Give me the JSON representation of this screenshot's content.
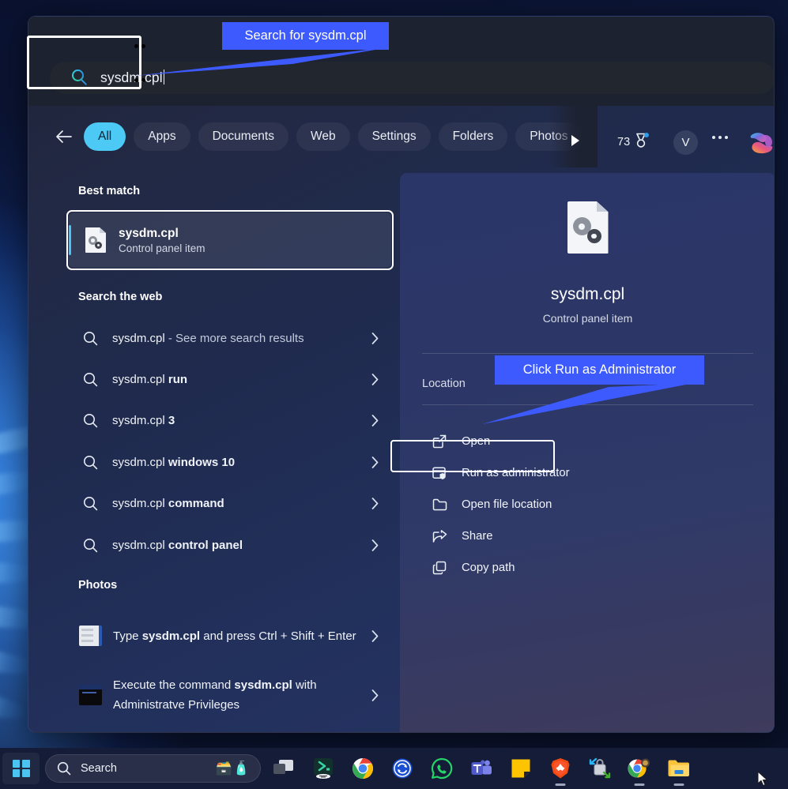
{
  "search": {
    "value": "sysdm.cpl",
    "icon": "search-icon"
  },
  "tabs": {
    "back_icon": "back-arrow-icon",
    "items": [
      {
        "label": "All",
        "active": true
      },
      {
        "label": "Apps",
        "active": false
      },
      {
        "label": "Documents",
        "active": false
      },
      {
        "label": "Web",
        "active": false
      },
      {
        "label": "Settings",
        "active": false
      },
      {
        "label": "Folders",
        "active": false
      },
      {
        "label": "Photos",
        "active": false
      }
    ],
    "scroll_next_icon": "play-right-icon",
    "rewards_count": "73",
    "rewards_icon": "medal-icon",
    "avatar_initial": "V",
    "more_icon": "ellipsis-icon",
    "copilot_icon": "copilot-icon"
  },
  "left": {
    "best_match_heading": "Best match",
    "best_match": {
      "title": "sysdm.cpl",
      "subtitle": "Control panel item",
      "icon": "cpl-file-icon"
    },
    "web_heading": "Search the web",
    "web_results": [
      {
        "query": "sysdm.cpl",
        "suffix": " - See more search results",
        "suffix_style": "dim"
      },
      {
        "query": "sysdm.cpl",
        "suffix": " run",
        "suffix_style": "bold"
      },
      {
        "query": "sysdm.cpl",
        "suffix": " 3",
        "suffix_style": "bold"
      },
      {
        "query": "sysdm.cpl",
        "suffix": " windows 10",
        "suffix_style": "bold"
      },
      {
        "query": "sysdm.cpl",
        "suffix": " command",
        "suffix_style": "bold"
      },
      {
        "query": "sysdm.cpl",
        "suffix": " control panel",
        "suffix_style": "bold"
      }
    ],
    "photos_heading": "Photos",
    "photos": [
      {
        "pre": "Type ",
        "bold": "sysdm.cpl",
        "post": " and press Ctrl + Shift + Enter",
        "thumb": "dialog-thumbnail"
      },
      {
        "pre": "Execute the command ",
        "bold": "sysdm.cpl",
        "post": " with Administratve Privileges",
        "thumb": "terminal-thumbnail"
      }
    ]
  },
  "preview": {
    "title": "sysdm.cpl",
    "subtitle": "Control panel item",
    "location_label": "Location",
    "actions": [
      {
        "label": "Open",
        "icon": "open-external-icon",
        "highlighted": false
      },
      {
        "label": "Run as administrator",
        "icon": "shield-window-icon",
        "highlighted": true
      },
      {
        "label": "Open file location",
        "icon": "folder-icon",
        "highlighted": false
      },
      {
        "label": "Share",
        "icon": "share-icon",
        "highlighted": false
      },
      {
        "label": "Copy path",
        "icon": "copy-icon",
        "highlighted": false
      }
    ]
  },
  "callouts": [
    {
      "text": "Search for sysdm.cpl",
      "color": "#3D5AFE"
    },
    {
      "text": "Click Run as Administrator",
      "color": "#3D5AFE"
    }
  ],
  "taskbar": {
    "start_icon": "windows-logo-icon",
    "search_placeholder": "Search",
    "search_icon": "search-icon",
    "search_emoji": "🗃️🧴",
    "apps": [
      {
        "name": "task-view-icon"
      },
      {
        "name": "app-green-icon"
      },
      {
        "name": "google-chrome-icon"
      },
      {
        "name": "sync-blue-icon"
      },
      {
        "name": "whatsapp-icon"
      },
      {
        "name": "microsoft-teams-icon"
      },
      {
        "name": "sticky-notes-icon"
      },
      {
        "name": "brave-browser-icon"
      },
      {
        "name": "unlocker-icon"
      },
      {
        "name": "chrome-secondary-icon"
      },
      {
        "name": "file-explorer-icon"
      }
    ]
  },
  "colors": {
    "accent_cyan": "#4CC9F5",
    "callout_blue": "#3D5AFE",
    "panel_dark": "#1D2231",
    "panel_blue": "#27345E"
  }
}
